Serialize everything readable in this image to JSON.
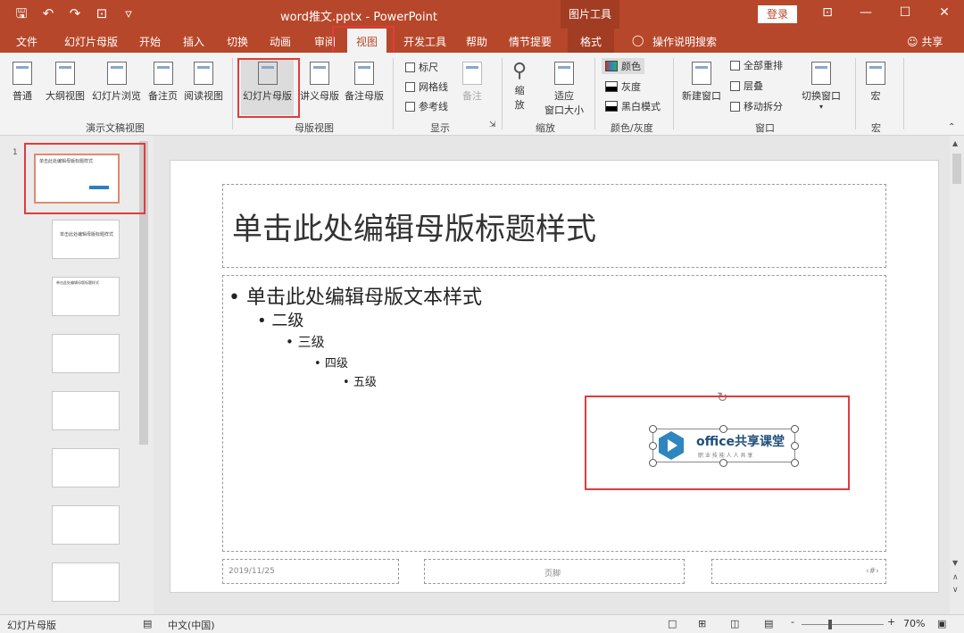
{
  "title_bar": {
    "qat_icons": [
      "save-icon",
      "undo-icon",
      "redo-icon",
      "start-from-beginning-icon",
      "customize-qat-icon"
    ],
    "qat_glyphs": [
      "🖫",
      "↶",
      "↷",
      "⊡",
      "▿"
    ],
    "document_title": "word推文.pptx  -  PowerPoint",
    "context_group": "图片工具",
    "login_label": "登录",
    "window_buttons": [
      "⊡",
      "—",
      "☐",
      "✕"
    ]
  },
  "tabs": {
    "file": "文件",
    "slide_master": "幻灯片母版",
    "home": "开始",
    "insert": "插入",
    "transitions": "切换",
    "animations": "动画",
    "review": "审阅",
    "view": "视图",
    "developer": "开发工具",
    "help": "帮助",
    "storyboard": "情节提要",
    "format": "格式",
    "tell_me": "操作说明搜索",
    "share": "共享"
  },
  "ribbon": {
    "presentation_views": {
      "normal": "普通",
      "outline": "大纲视图",
      "slide_sorter": "幻灯片浏览",
      "notes_page": "备注页",
      "reading_view": "阅读视图",
      "group_label": "演示文稿视图"
    },
    "master_views": {
      "slide_master": "幻灯片母版",
      "handout_master": "讲义母版",
      "notes_master": "备注母版",
      "group_label": "母版视图"
    },
    "show": {
      "ruler": "标尺",
      "gridlines": "网格线",
      "guides": "参考线",
      "notes": "备注",
      "group_label": "显示"
    },
    "zoom": {
      "zoom_line1": "缩",
      "zoom_line2": "放",
      "fit_line1": "适应",
      "fit_line2": "窗口大小",
      "group_label": "缩放"
    },
    "color": {
      "color": "颜色",
      "grayscale": "灰度",
      "bw": "黑白模式",
      "group_label": "颜色/灰度"
    },
    "window": {
      "new_window": "新建窗口",
      "arrange_all": "全部重排",
      "cascade": "层叠",
      "move_split": "移动拆分",
      "switch_windows": "切换窗口",
      "group_label": "窗口"
    },
    "macros": {
      "macros": "宏",
      "group_label": "宏"
    },
    "accent": "#b7472a"
  },
  "thumbnails": {
    "master_title": "单击此处编辑母版标题样式",
    "layout2_title": "单击此处编辑母版标题样式",
    "layout3_title": "单击此处编辑母版标题样式"
  },
  "slide": {
    "title": "单击此处编辑母版标题样式",
    "levels": [
      "单击此处编辑母版文本样式",
      "二级",
      "三级",
      "四级",
      "五级"
    ],
    "footer_date": "2019/11/25",
    "footer_text": "页脚",
    "footer_number": "‹#›",
    "logo_brand": "office共享课堂",
    "logo_slogan": "职 业 技 能 人 人 共 享"
  },
  "status": {
    "mode": "幻灯片母版",
    "language": "中文(中国)",
    "zoom_percent": "70%",
    "zoom_minus": "-",
    "zoom_plus": "+"
  }
}
